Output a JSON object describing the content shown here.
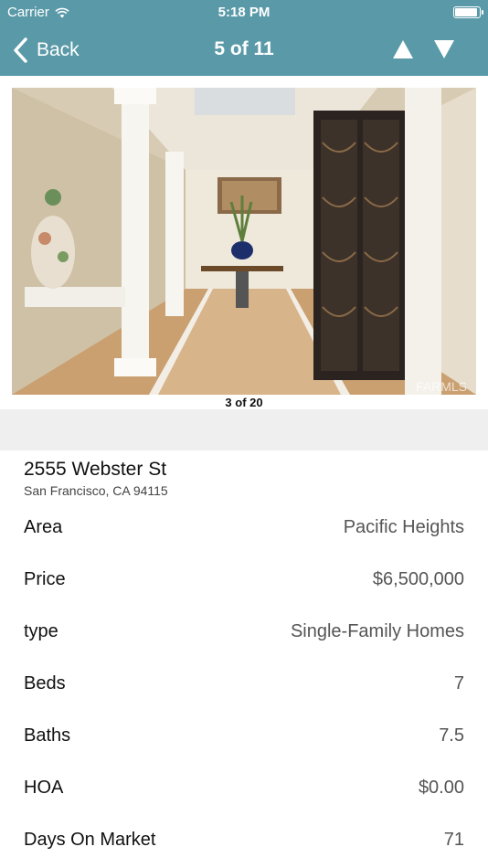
{
  "status_bar": {
    "carrier": "Carrier",
    "time": "5:18 PM",
    "battery_level": 0.95
  },
  "nav": {
    "back_label": "Back",
    "title": "5 of 11",
    "up_icon": "triangle-up-icon",
    "down_icon": "triangle-down-icon",
    "bar_color": "#5a9aa8"
  },
  "photo": {
    "counter": "3 of 20",
    "watermark": "FARMLS"
  },
  "listing": {
    "street": "2555 Webster St",
    "city": "San Francisco, CA 94115",
    "details": [
      {
        "label": "Area",
        "value": "Pacific Heights"
      },
      {
        "label": "Price",
        "value": "$6,500,000"
      },
      {
        "label": "type",
        "value": "Single-Family Homes"
      },
      {
        "label": "Beds",
        "value": "7"
      },
      {
        "label": "Baths",
        "value": "7.5"
      },
      {
        "label": "HOA",
        "value": "$0.00"
      },
      {
        "label": "Days On Market",
        "value": "71"
      }
    ]
  }
}
